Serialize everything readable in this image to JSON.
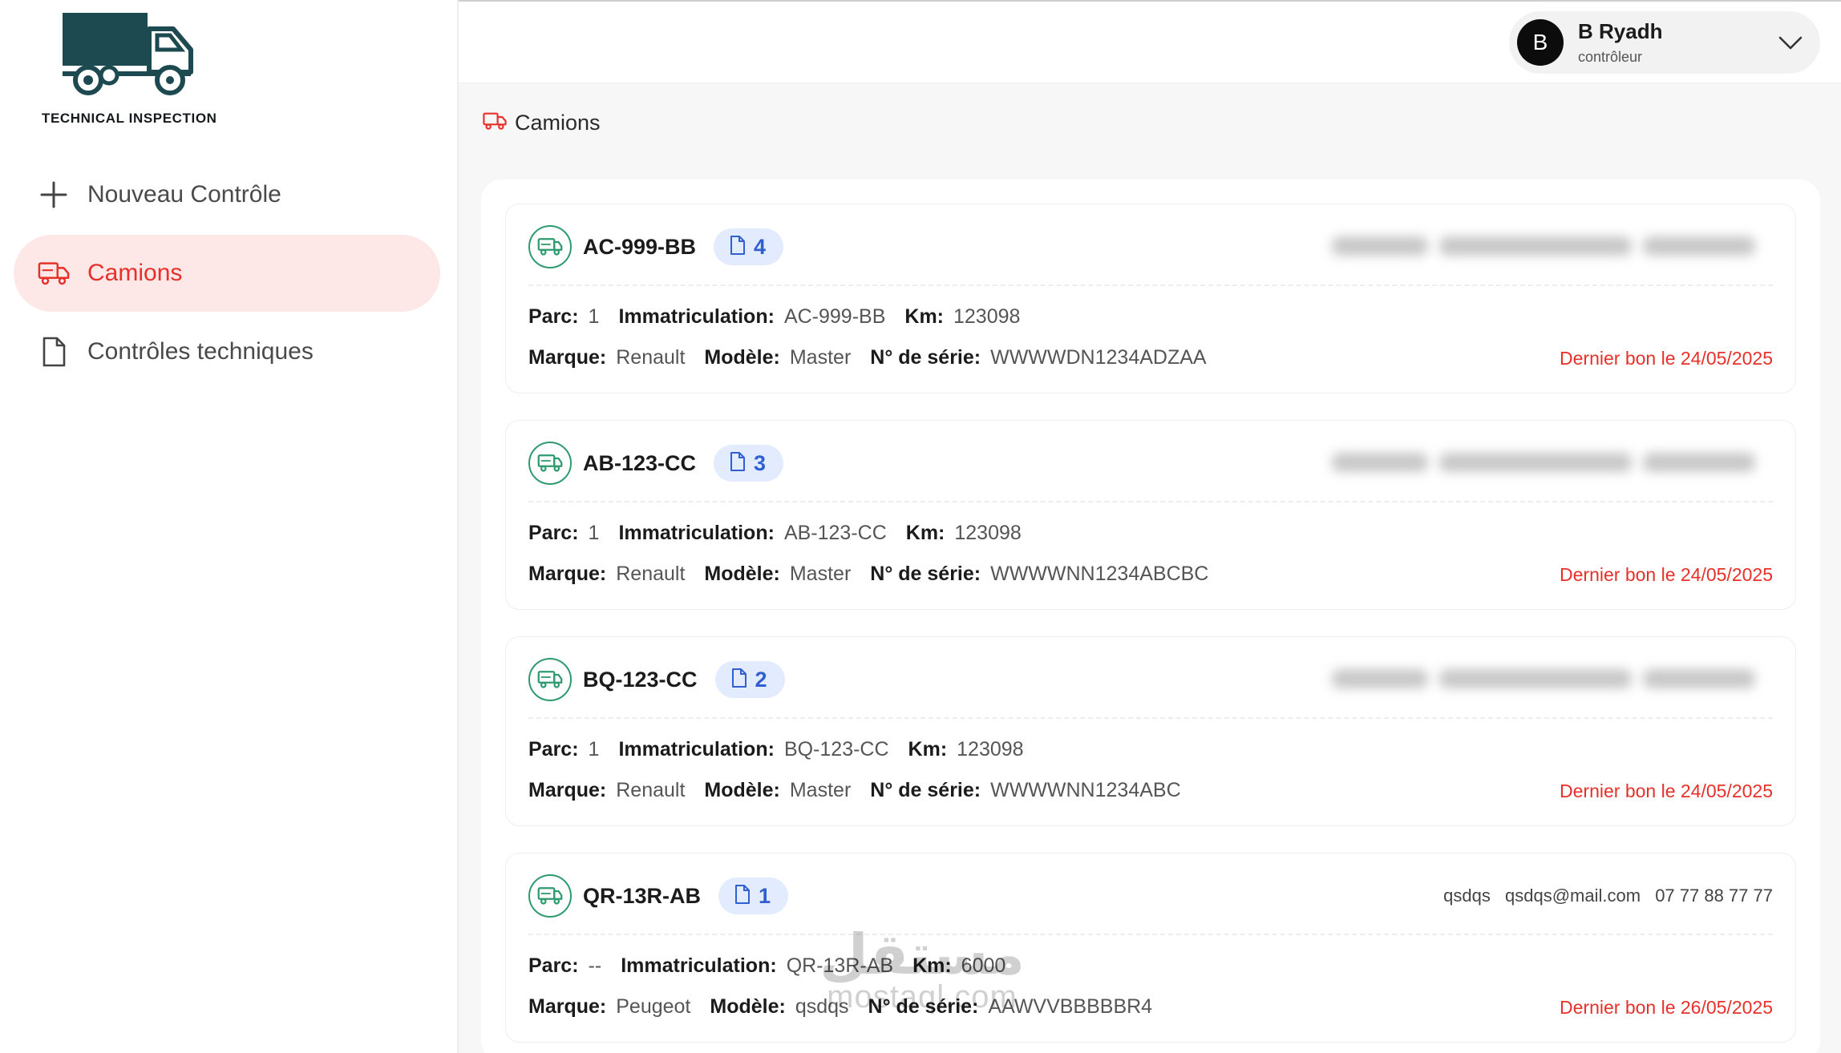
{
  "app": {
    "logo_text": "TECHNICAL INSPECTION"
  },
  "sidebar": {
    "items": [
      {
        "label": "Nouveau Contrôle",
        "icon": "plus-icon",
        "active": false
      },
      {
        "label": "Camions",
        "icon": "truck-icon",
        "active": true
      },
      {
        "label": "Contrôles techniques",
        "icon": "document-icon",
        "active": false
      }
    ]
  },
  "user": {
    "initial": "B",
    "name": "B Ryadh",
    "role": "contrôleur"
  },
  "page": {
    "title": "Camions"
  },
  "labels": {
    "parc": "Parc:",
    "immatriculation": "Immatriculation:",
    "km": "Km:",
    "marque": "Marque:",
    "modele": "Modèle:",
    "serie": "N° de série:"
  },
  "trucks": [
    {
      "plate": "AC-999-BB",
      "docs": "4",
      "parc": "1",
      "immatriculation": "AC-999-BB",
      "km": "123098",
      "marque": "Renault",
      "modele": "Master",
      "serie": "WWWWDN1234ADZAA",
      "last_bon": "Dernier bon le 24/05/2025",
      "contact_blurred": true
    },
    {
      "plate": "AB-123-CC",
      "docs": "3",
      "parc": "1",
      "immatriculation": "AB-123-CC",
      "km": "123098",
      "marque": "Renault",
      "modele": "Master",
      "serie": "WWWWNN1234ABCBC",
      "last_bon": "Dernier bon le 24/05/2025",
      "contact_blurred": true
    },
    {
      "plate": "BQ-123-CC",
      "docs": "2",
      "parc": "1",
      "immatriculation": "BQ-123-CC",
      "km": "123098",
      "marque": "Renault",
      "modele": "Master",
      "serie": "WWWWNN1234ABC",
      "last_bon": "Dernier bon le 24/05/2025",
      "contact_blurred": true
    },
    {
      "plate": "QR-13R-AB",
      "docs": "1",
      "parc": "--",
      "immatriculation": "QR-13R-AB",
      "km": "6000",
      "marque": "Peugeot",
      "modele": "qsdqs",
      "serie": "AAWVVBBBBBR4",
      "last_bon": "Dernier bon le 26/05/2025",
      "contact_blurred": false,
      "contact": {
        "name": "qsdqs",
        "email": "qsdqs@mail.com",
        "phone": "07 77 88 77 77"
      }
    }
  ],
  "watermark": {
    "arabic": "مستقل",
    "latin": "mostaql.com"
  },
  "colors": {
    "accent_red": "#e8302a",
    "active_bg": "#fde7e7",
    "badge_bg": "#e3ecff",
    "badge_text": "#2f5fd1",
    "truck_green": "#2e9b6f",
    "logo_dark": "#1d4a50"
  }
}
